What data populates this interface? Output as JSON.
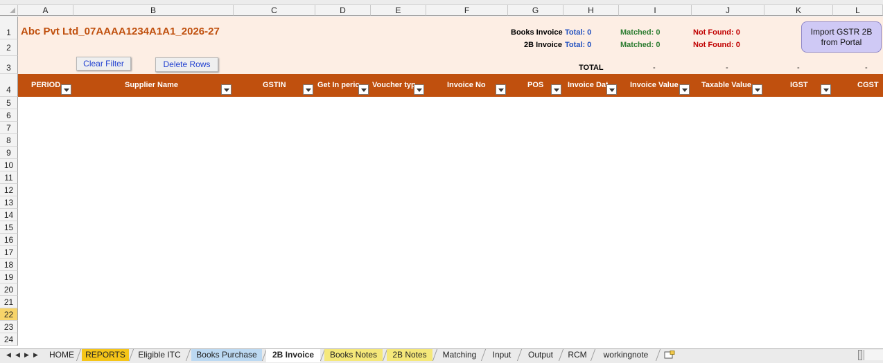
{
  "columns": [
    "A",
    "B",
    "C",
    "D",
    "E",
    "F",
    "G",
    "H",
    "I",
    "J",
    "K",
    "L"
  ],
  "rows": [
    "1",
    "2",
    "3",
    "4",
    "5",
    "6",
    "7",
    "8",
    "9",
    "10",
    "11",
    "12",
    "13",
    "14",
    "15",
    "16",
    "17",
    "18",
    "19",
    "20",
    "21",
    "22",
    "23",
    "24"
  ],
  "selected_row": "22",
  "title": "Abc Pvt Ltd_07AAAA1234A1A1_2026-27",
  "summary": {
    "books_label": "Books Invoice",
    "books_total": "Total: 0",
    "books_matched": "Matched: 0",
    "books_notfound": "Not Found: 0",
    "twob_label": "2B Invoice",
    "twob_total": "Total: 0",
    "twob_matched": "Matched: 0",
    "twob_notfound": "Not Found: 0",
    "total_label": "TOTAL",
    "total_values": [
      "-",
      "-",
      "-",
      "-"
    ]
  },
  "buttons": {
    "clear_filter": "Clear Filter",
    "delete_rows": "Delete Rows",
    "import_line1": "Import GSTR 2B",
    "import_line2": "from Portal"
  },
  "headers": [
    "PERIOD",
    "Supplier Name",
    "GSTIN",
    "Get In period",
    "Voucher type",
    "Invoice No",
    "POS",
    "Invoice Date",
    "Invoice Value",
    "Taxable Value",
    "IGST",
    "CGST"
  ],
  "sheet_tabs": [
    "HOME",
    "REPORTS",
    "Eligible ITC",
    "Books Purchase",
    "2B Invoice",
    "Books Notes",
    "2B Notes",
    "Matching",
    "Input",
    "Output",
    "RCM",
    "workingnote"
  ],
  "active_tab": "2B Invoice",
  "colors": {
    "accent": "#c0500e",
    "band": "#fdeee4",
    "total_blue": "#1f4fbf",
    "matched_green": "#2e7d32",
    "notfound_red": "#c00000",
    "tab_reports": "#f5c518",
    "tab_books_purchase": "#bcd9f2",
    "tab_yellow": "#f5e87a"
  },
  "icons": [
    "select-all-icon",
    "first-sheet-icon",
    "prev-sheet-icon",
    "next-sheet-icon",
    "last-sheet-icon",
    "insert-sheet-icon",
    "filter-dropdown-icon"
  ]
}
